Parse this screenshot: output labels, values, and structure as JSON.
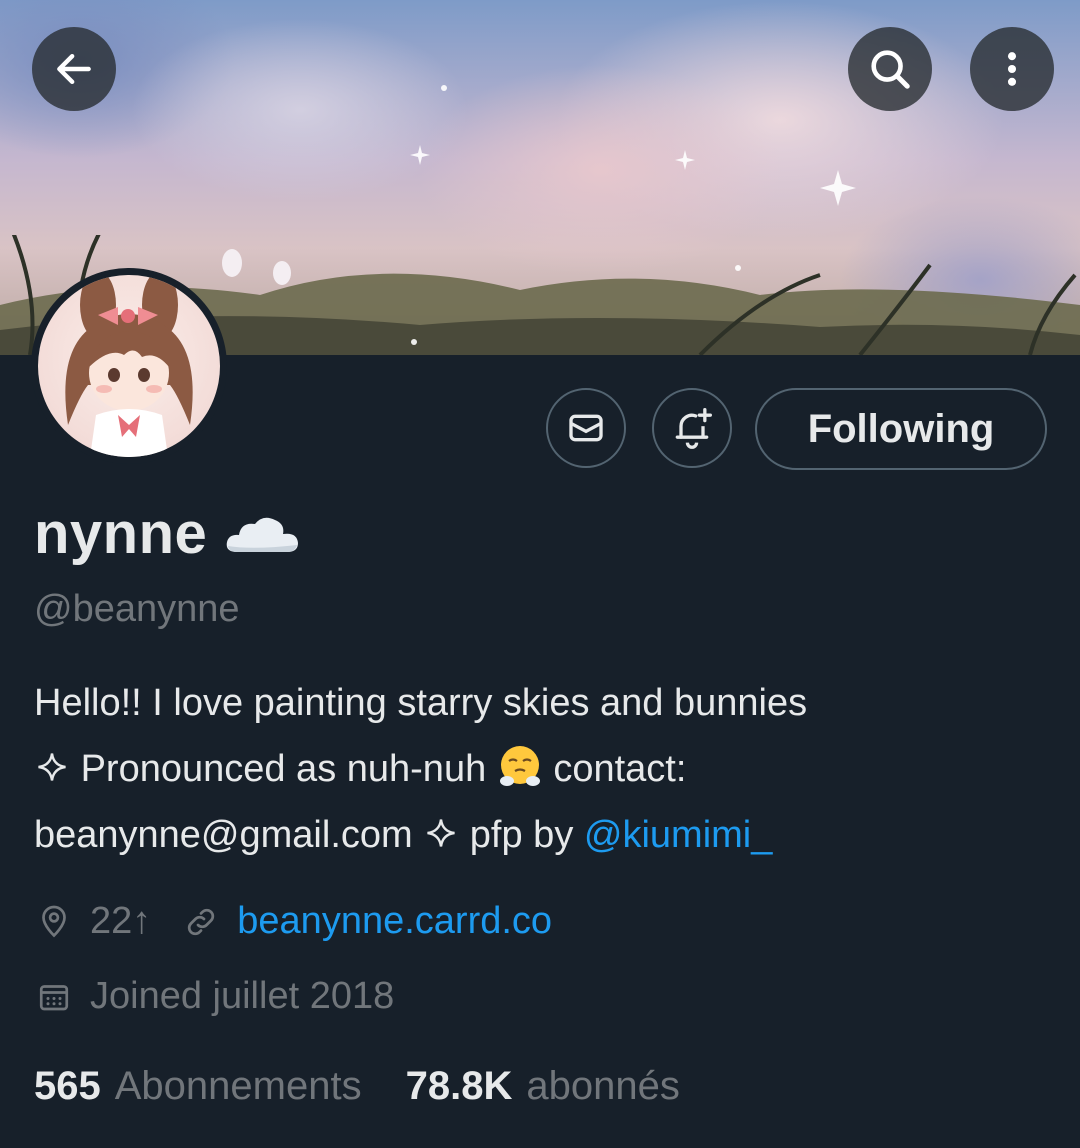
{
  "profile": {
    "display_name": "nynne",
    "name_emoji": "cloud",
    "handle": "@beanynne",
    "bio": {
      "line1": "Hello!! I love painting starry skies and bunnies",
      "line2_a": "Pronounced as nuh-nuh",
      "line2_b": "contact:",
      "line3_a": "beanynne@gmail.com",
      "line3_b": "pfp by",
      "mention": "@kiumimi_"
    },
    "location": "22↑",
    "website": "beanynne.carrd.co",
    "joined": "Joined juillet 2018",
    "following_count": "565",
    "following_label": "Abonnements",
    "followers_count": "78.8K",
    "followers_label": "abonnés"
  },
  "actions": {
    "follow_label": "Following"
  },
  "icons": {
    "back": "back-arrow-icon",
    "search": "search-icon",
    "more": "more-vertical-icon",
    "message": "mail-icon",
    "notify": "bell-plus-icon",
    "location": "location-pin-icon",
    "link": "link-icon",
    "calendar": "calendar-icon"
  },
  "colors": {
    "background": "#17202a",
    "accent": "#1d9bf0",
    "muted": "#71767b",
    "border": "#536471"
  }
}
